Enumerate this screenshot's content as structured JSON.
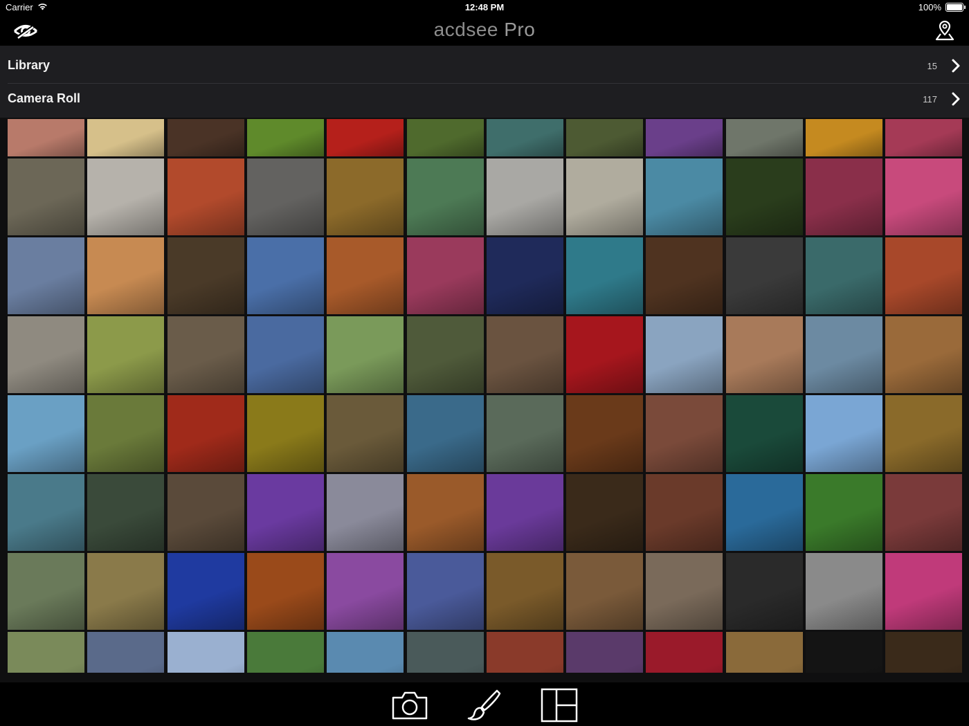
{
  "status_bar": {
    "carrier": "Carrier",
    "time": "12:48 PM",
    "battery": "100%"
  },
  "nav": {
    "logo_main": "acdsee",
    "logo_pro": "Pro",
    "left_icon": "eye-icon",
    "right_icon": "location-pin-icon"
  },
  "rows": [
    {
      "label": "Library",
      "count": "15"
    },
    {
      "label": "Camera Roll",
      "count": "117"
    }
  ],
  "grid": {
    "columns": 12,
    "visible_rows": 8
  },
  "toolbar": {
    "items": [
      "camera-icon",
      "brush-icon",
      "layout-icon"
    ]
  },
  "colors": {
    "thumbs": [
      [
        "#b87a6a",
        "#d6c08a",
        "#4a3326",
        "#5f8a2b",
        "#b5201b",
        "#4f6a2d",
        "#3f6e6b",
        "#4d5a33",
        "#6a3f8a",
        "#6f766a",
        "#c58a20",
        "#a53a56"
      ],
      [
        "#6c6757",
        "#b6b2ab",
        "#b24a2c",
        "#636260",
        "#8c6a2a",
        "#4d7a55",
        "#a9a8a4",
        "#b0ac9e",
        "#4b8aa4",
        "#2a3d1c",
        "#8a2f4a",
        "#c84a7c"
      ],
      [
        "#6a7ea0",
        "#c78a52",
        "#4a3a28",
        "#4a6fa8",
        "#a85a2a",
        "#9a3a5c",
        "#1f2a5a",
        "#2f7a8a",
        "#4f3320",
        "#3a3a3a",
        "#3a6a6a",
        "#a8482a"
      ],
      [
        "#8f8a80",
        "#8c9a4a",
        "#6a5c4a",
        "#4a6aa0",
        "#7a9a5a",
        "#4f5a3a",
        "#6a5340",
        "#a6161d",
        "#8aa4c0",
        "#a87a5a",
        "#6c8aa2",
        "#9a6a3a"
      ],
      [
        "#6aa0c4",
        "#6a7a3a",
        "#a02a1a",
        "#8a7a1a",
        "#6a5a3a",
        "#3a6a8a",
        "#5a6a5a",
        "#6a3a1a",
        "#7a4a3a",
        "#1a4a3a",
        "#7aa6d4",
        "#8a6a2a"
      ],
      [
        "#4a7a8a",
        "#3a4a3a",
        "#5a4a3a",
        "#6a3aa0",
        "#8a8a9a",
        "#9a5a2a",
        "#6a3a9a",
        "#3a2a1a",
        "#6a3a2a",
        "#2a6a9a",
        "#3a7a2a",
        "#7a3a3a"
      ],
      [
        "#6a7a5a",
        "#8a7a4a",
        "#1f3aa0",
        "#9a4a1a",
        "#8a4aa0",
        "#4a5a9a",
        "#7a5a2a",
        "#7a5a3a",
        "#7a6a5a",
        "#2a2a2a",
        "#8a8a8a",
        "#c03a7a"
      ],
      [
        "#7a8a5a",
        "#5a6a8a",
        "#9ab0d0",
        "#4a7a3a",
        "#5a8ab0",
        "#4a5a5a",
        "#8a3a2a",
        "#5a3a6a",
        "#9a1a2a",
        "#8a6a3a",
        "#141414",
        "#3a2a1a"
      ]
    ]
  }
}
